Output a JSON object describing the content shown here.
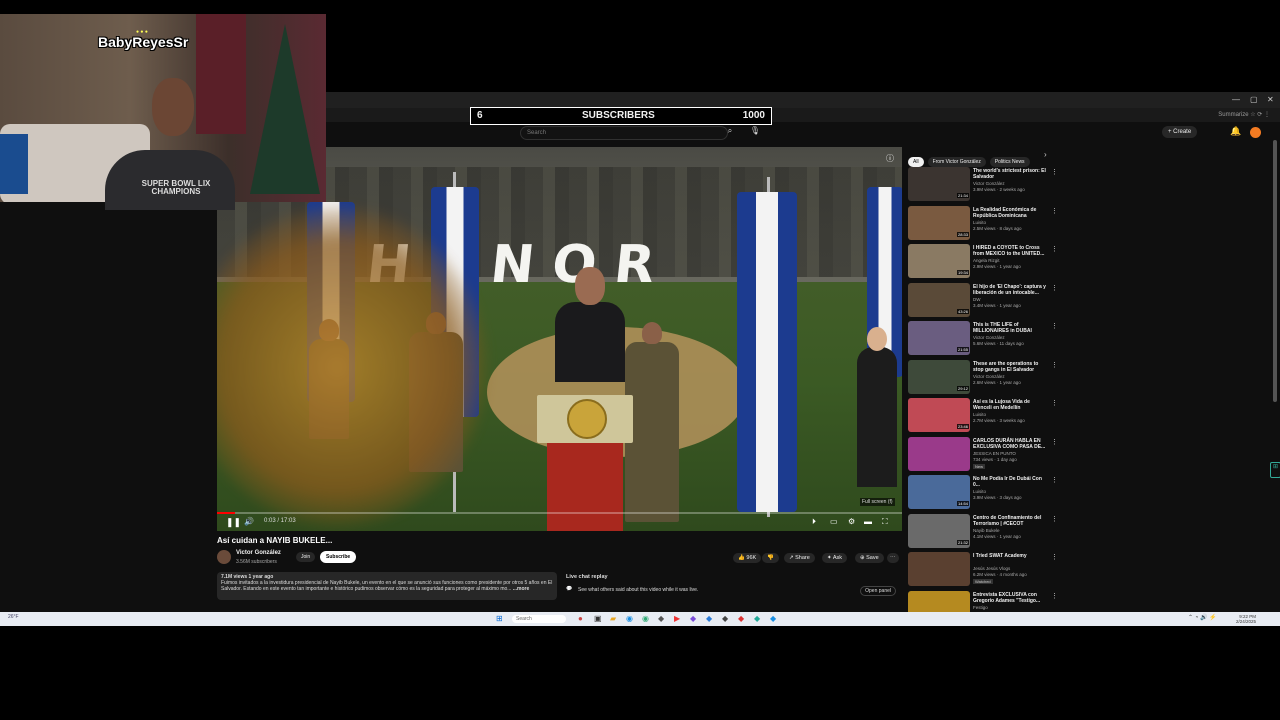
{
  "overlay": {
    "sub_count": "6",
    "sub_label": "SUBSCRIBERS",
    "sub_goal": "1000"
  },
  "webcam": {
    "watermark": "BabyReyesSr",
    "shirt_line1": "SUPER BOWL LIX",
    "shirt_line2": "CHAMPIONS"
  },
  "browser": {
    "profile_label": "Summarize",
    "urlbar_icons": "☆ ⟳ ⋮"
  },
  "youtube": {
    "search_placeholder": "Search",
    "create_label": "+ Create",
    "video": {
      "title": "Así cuidan a NAYIB BUKELE...",
      "time": "0:03 / 17:03",
      "fullscreen_tip": "Full screen (f)",
      "progress_fraction": 0.003
    },
    "channel": {
      "name": "Victor González",
      "subs": "3.56M subscribers",
      "join_label": "Join",
      "subscribe_label": "Subscribe"
    },
    "actions": {
      "like_count": "96K",
      "share_label": "Share",
      "ask_label": "Ask",
      "save_label": "Save"
    },
    "description": {
      "meta": "7.1M views  1 year ago",
      "text": "Fuimos invitados a la investidura presidencial de Nayib Bukele, un evento en el que se anunció sus funciones como presidente por otros 5 años en El Salvador. Estando en este evento tan importante e histórico pudimos observar cómo es la seguridad para proteger al máximo mo...",
      "more": "...more"
    },
    "live_chat": {
      "title": "Live chat replay",
      "text": "See what others said about this video while it was live.",
      "open_label": "Open panel"
    },
    "chips": [
      "All",
      "From Victor González",
      "Politics News"
    ],
    "recommendations": [
      {
        "title": "The world's strictest prison: El Salvador",
        "channel": "Victor González",
        "meta": "3.9M views · 2 weeks ago",
        "duration": "21:34",
        "color": "#3b3430",
        "badge": ""
      },
      {
        "title": "La Realidad Económica de República Dominicana",
        "channel": "Luisito",
        "meta": "2.5M views · 8 days ago",
        "duration": "28:33",
        "color": "#7a5a40",
        "badge": ""
      },
      {
        "title": "I HIRED a COYOTE to Cross from MEXICO to the UNITED...",
        "channel": "Angela Rizgit",
        "meta": "2.9M views · 1 year ago",
        "duration": "19:34",
        "color": "#8a7a63",
        "badge": ""
      },
      {
        "title": "El hijo de 'El Chapo': captura y liberación de un intocable...",
        "channel": "DW",
        "meta": "3.4M views · 1 year ago",
        "duration": "43:26",
        "color": "#5a4a38",
        "badge": ""
      },
      {
        "title": "This is THE LIFE of MILLIONAIRES in DUBAI",
        "channel": "Victor González",
        "meta": "5.6M views · 11 days ago",
        "duration": "21:55",
        "color": "#6a5d80",
        "badge": ""
      },
      {
        "title": "These are the operations to stop gangs in El Salvador",
        "channel": "Victor González",
        "meta": "2.6M views · 1 year ago",
        "duration": "29:12",
        "color": "#3e4a3a",
        "badge": ""
      },
      {
        "title": "Así es la Lujosa Vida de Wenceli en Medellín",
        "channel": "Luisito",
        "meta": "2.7M views · 3 weeks ago",
        "duration": "23:46",
        "color": "#c04a55",
        "badge": ""
      },
      {
        "title": "CARLOS DURÁN HABLA EN EXCLUSIVA COMO PASA DE...",
        "channel": "JESSICA EN PUNTO",
        "meta": "734 views · 1 day ago",
        "duration": "",
        "color": "#9a3a8a",
        "badge": "New"
      },
      {
        "title": "No Me Podía Ir De Dubái Con 0...",
        "channel": "Luisito",
        "meta": "3.9M views · 3 days ago",
        "duration": "14:54",
        "color": "#4a6a9a",
        "badge": ""
      },
      {
        "title": "Centro de Confinamiento del Terrorismo | #CECOT",
        "channel": "Nayib Bukele",
        "meta": "4.1M views · 1 year ago",
        "duration": "21:32",
        "color": "#6a6a6a",
        "badge": ""
      },
      {
        "title": "I Tried SWAT Academy",
        "channel": "Jesús Jesús Vlogs",
        "meta": "6.2M views · 4 months ago",
        "duration": "",
        "color": "#5a4030",
        "badge": "Watched"
      },
      {
        "title": "Entrevista EXCLUSIVA con Gregorio Adames \"Testigo...",
        "channel": "Festigo",
        "meta": "",
        "duration": "",
        "color": "#b58a20",
        "badge": ""
      }
    ]
  },
  "taskbar": {
    "weather": "26°F",
    "search_placeholder": "Search",
    "time": "9:22 PM",
    "date": "2/24/2025"
  }
}
